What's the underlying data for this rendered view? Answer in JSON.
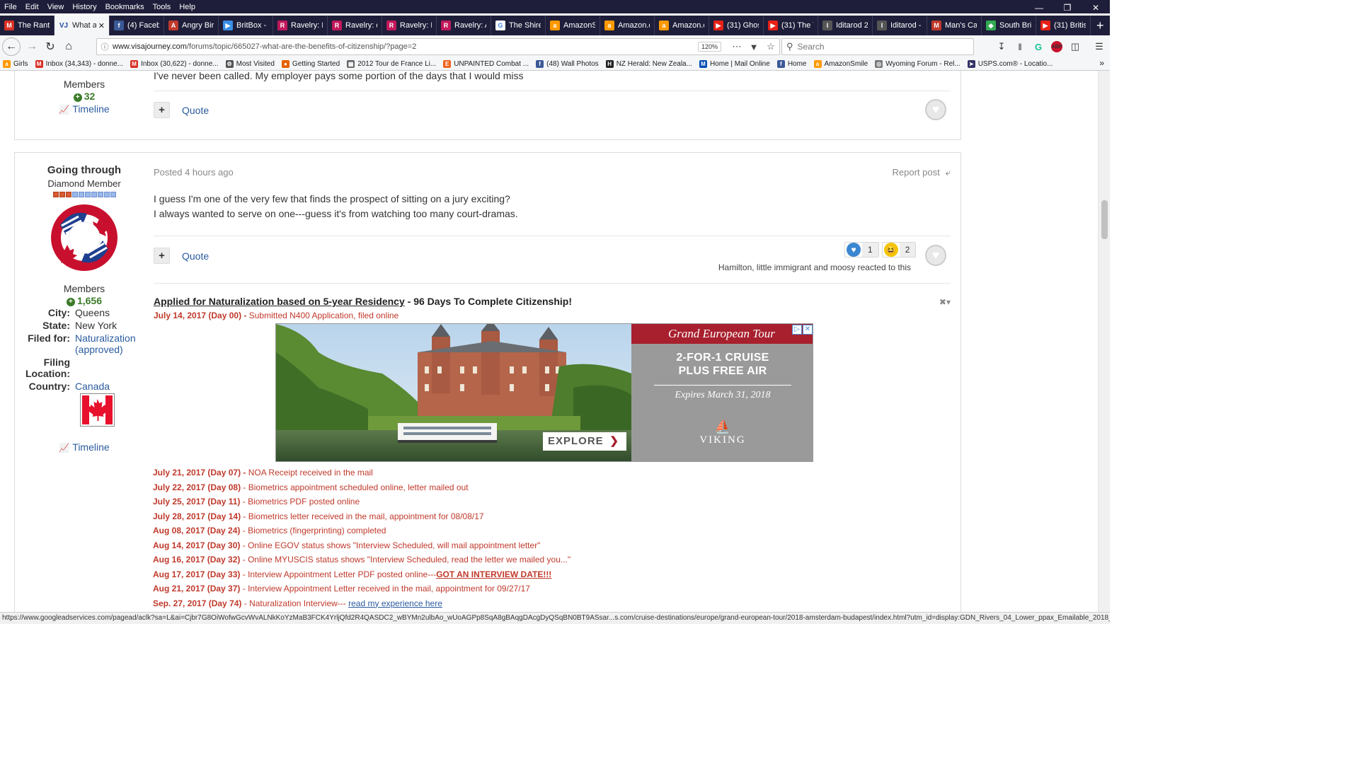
{
  "menu": [
    "File",
    "Edit",
    "View",
    "History",
    "Bookmarks",
    "Tools",
    "Help"
  ],
  "tabs": [
    {
      "label": "The Rant",
      "icon": "gmail-icon",
      "color": "#d93025",
      "glyph": "M"
    },
    {
      "label": "What a",
      "icon": "vj-icon",
      "color": "#224ca8",
      "glyph": "VJ",
      "active": true
    },
    {
      "label": "(4) Faceb",
      "icon": "facebook-icon",
      "color": "#3b5998",
      "glyph": "f"
    },
    {
      "label": "Angry Bir",
      "icon": "angry-birds-icon",
      "color": "#c0392b",
      "glyph": "A"
    },
    {
      "label": "BritBox - ",
      "icon": "britbox-icon",
      "color": "#3a8ee6",
      "glyph": "▶"
    },
    {
      "label": "Ravelry: P",
      "icon": "ravelry-icon",
      "color": "#c2185b",
      "glyph": "R"
    },
    {
      "label": "Ravelry: d",
      "icon": "ravelry-icon",
      "color": "#c2185b",
      "glyph": "R"
    },
    {
      "label": "Ravelry: K",
      "icon": "ravelry-icon",
      "color": "#c2185b",
      "glyph": "R"
    },
    {
      "label": "Ravelry: A",
      "icon": "ravelry-icon",
      "color": "#c2185b",
      "glyph": "R"
    },
    {
      "label": "The Shire",
      "icon": "google-icon",
      "color": "#ffffff",
      "glyph": "G"
    },
    {
      "label": "AmazonS",
      "icon": "amazon-icon",
      "color": "#ff9900",
      "glyph": "a"
    },
    {
      "label": "Amazon.c",
      "icon": "amazon-icon",
      "color": "#ff9900",
      "glyph": "a"
    },
    {
      "label": "Amazon.c",
      "icon": "amazon-icon",
      "color": "#ff9900",
      "glyph": "a"
    },
    {
      "label": "(31) Ghost",
      "icon": "youtube-icon",
      "color": "#e62117",
      "glyph": "▶"
    },
    {
      "label": "(31) The T",
      "icon": "youtube-icon",
      "color": "#e62117",
      "glyph": "▶"
    },
    {
      "label": "Iditarod 2",
      "icon": "iditarod-icon",
      "color": "#555555",
      "glyph": "I"
    },
    {
      "label": "Iditarod -",
      "icon": "iditarod-icon",
      "color": "#555555",
      "glyph": "I"
    },
    {
      "label": "Man's Ca",
      "icon": "mans-cave-icon",
      "color": "#c0392b",
      "glyph": "M"
    },
    {
      "label": "South Bri",
      "icon": "maps-icon",
      "color": "#34a853",
      "glyph": "◆"
    },
    {
      "label": "(31) Britisl",
      "icon": "youtube-icon",
      "color": "#e62117",
      "glyph": "▶"
    }
  ],
  "nav": {
    "url_domain": "www.visajourney.com",
    "url_path": "/forums/topic/665027-what-are-the-benefits-of-citizenship/?page=2",
    "zoom": "120%",
    "search_placeholder": "Search"
  },
  "bookmarks": [
    {
      "label": "Girls",
      "icon": "amazon-icon",
      "color": "#ff9900",
      "glyph": "a"
    },
    {
      "label": "Inbox (34,343) - donne...",
      "icon": "gmail-icon",
      "color": "#d93025",
      "glyph": "M"
    },
    {
      "label": "Inbox (30,622) - donne...",
      "icon": "gmail-icon",
      "color": "#d93025",
      "glyph": "M"
    },
    {
      "label": "Most Visited",
      "icon": "gear-icon",
      "color": "#555555",
      "glyph": "⚙"
    },
    {
      "label": "Getting Started",
      "icon": "firefox-icon",
      "color": "#e66000",
      "glyph": "●"
    },
    {
      "label": "2012 Tour de France Li...",
      "icon": "page-icon",
      "color": "#666666",
      "glyph": "▦"
    },
    {
      "label": "UNPAINTED Combat ...",
      "icon": "etsy-icon",
      "color": "#f1641e",
      "glyph": "E"
    },
    {
      "label": "(48) Wall Photos",
      "icon": "facebook-icon",
      "color": "#3b5998",
      "glyph": "f"
    },
    {
      "label": "NZ Herald: New Zeala...",
      "icon": "nzh-icon",
      "color": "#222222",
      "glyph": "H"
    },
    {
      "label": "Home | Mail Online",
      "icon": "dailymail-icon",
      "color": "#004db3",
      "glyph": "M"
    },
    {
      "label": "Home",
      "icon": "facebook-icon",
      "color": "#3b5998",
      "glyph": "f"
    },
    {
      "label": "AmazonSmile",
      "icon": "amazon-icon",
      "color": "#ff9900",
      "glyph": "a"
    },
    {
      "label": "Wyoming Forum - Rel...",
      "icon": "forum-icon",
      "color": "#777777",
      "glyph": "◎"
    },
    {
      "label": "USPS.com® - Locatio...",
      "icon": "usps-icon",
      "color": "#333366",
      "glyph": "➤"
    }
  ],
  "post1": {
    "partial_text": "I've never been called. My employer pays some portion of the days that I would miss",
    "group": "Members",
    "reputation": "32",
    "timeline": "Timeline",
    "quote": "Quote"
  },
  "post2": {
    "username": "Going through",
    "title": "Diamond Member",
    "group": "Members",
    "reputation": "1,656",
    "fields": [
      {
        "k": "City:",
        "v": "Queens"
      },
      {
        "k": "State:",
        "v": "New York"
      },
      {
        "k": "Filed for:",
        "v": "Naturalization (approved)"
      },
      {
        "k": "Filing Location:",
        "v": ""
      },
      {
        "k": "Country:",
        "v": "Canada"
      }
    ],
    "timeline": "Timeline",
    "posted": "Posted 4 hours ago",
    "report": "Report post",
    "text_line1": "I guess I'm one of the very few that finds the prospect of sitting on a jury exciting?",
    "text_line2": "I always wanted to serve on one---guess it's from watching too many court-dramas.",
    "quote": "Quote",
    "reactions": [
      {
        "name": "like",
        "count": "1",
        "color": "#3a86d1",
        "glyph": "♥"
      },
      {
        "name": "haha",
        "count": "2",
        "color": "#f5c400",
        "glyph": "😆"
      }
    ],
    "reacted_text": "Hamilton, little immigrant and moosy reacted to this"
  },
  "signature": {
    "headline_link": "Applied for Naturalization based on 5-year Residency",
    "headline_rest": " - 96 Days To Complete Citizenship!",
    "first": {
      "date": "July 14, 2017 (Day 00) -",
      "text": "  Submitted N400 Application, filed online"
    },
    "timeline": [
      {
        "date": "July 21, 2017 (Day 07) -",
        "text": "  NOA Receipt received in the mail"
      },
      {
        "date": "July 22, 2017 (Day 08)",
        "text": " - Biometrics appointment scheduled online, letter mailed out"
      },
      {
        "date": "July 25, 2017 (Day 11)",
        "text": " - Biometrics PDF posted online"
      },
      {
        "date": "July 28, 2017 (Day 14)",
        "text": " - Biometrics letter received in the mail, appointment for 08/08/17"
      },
      {
        "date": "Aug 08, 2017 (Day 24)",
        "text": " - Biometrics (fingerprinting) completed"
      },
      {
        "date": "Aug 14, 2017 (Day 30)",
        "text": " - Online EGOV status shows \"Interview Scheduled, will mail appointment letter\""
      },
      {
        "date": "Aug 16, 2017 (Day 32)",
        "text": " - Online MYUSCIS status shows \"Interview Scheduled, read the letter we mailed you...\""
      },
      {
        "date": "Aug 17, 2017 (Day 33)",
        "text": " - Interview Appointment Letter PDF posted online---",
        "emph": "GOT AN INTERVIEW DATE!!!"
      },
      {
        "date": "Aug 21, 2017 (Day 37)",
        "text": " - Interview Appointment Letter received in the mail, appointment for 09/27/17"
      },
      {
        "date": "Sep. 27, 2017 (Day 74)",
        "text": " - Naturalization Interview--- ",
        "link": "read my experience here"
      }
    ]
  },
  "ad": {
    "top": "Grand European Tour",
    "line1": "2-FOR-1 CRUISE",
    "line2": "PLUS FREE AIR",
    "expires": "Expires March 31, 2018",
    "brand": "VIKING",
    "cta": "EXPLORE"
  },
  "status_url": "https://www.googleadservices.com/pagead/aclk?sa=L&ai=Cjbr7G8OiWofwGcvWvALNkKoYzMaB3FCK4YrljQfd2R4QASDC2_wBYMn2ulbAo_wUoAGPp8SqA8gBAqgDAcgDyQSqBN0BT9ASsar...s.com/cruise-destinations/europe/grand-european-tour/2018-amsterdam-budapest/index.html?utm_id=display:GDN_Rivers_04_Lower_ppax_Emailable_2018_Female_55"
}
